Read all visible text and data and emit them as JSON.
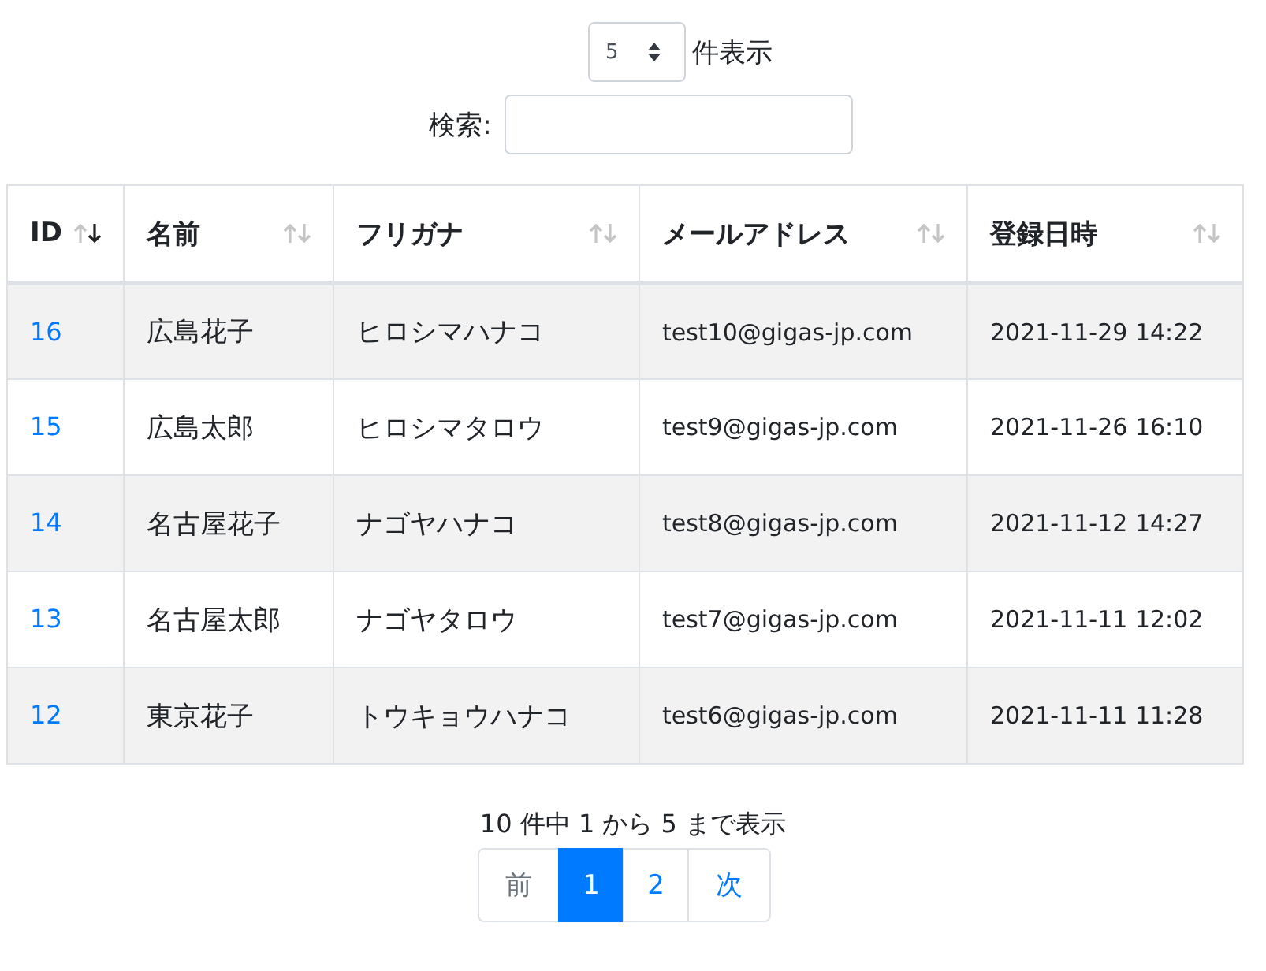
{
  "length_menu": {
    "value": "5",
    "label": "件表示"
  },
  "search": {
    "label": "検索:"
  },
  "table": {
    "columns": [
      {
        "label": "ID",
        "sorted": true
      },
      {
        "label": "名前",
        "sorted": false
      },
      {
        "label": "フリガナ",
        "sorted": false
      },
      {
        "label": "メールアドレス",
        "sorted": false
      },
      {
        "label": "登録日時",
        "sorted": false
      }
    ],
    "rows": [
      [
        "16",
        "広島花子",
        "ヒロシマハナコ",
        "test10@gigas-jp.com",
        "2021-11-29 14:22"
      ],
      [
        "15",
        "広島太郎",
        "ヒロシマタロウ",
        "test9@gigas-jp.com",
        "2021-11-26 16:10"
      ],
      [
        "14",
        "名古屋花子",
        "ナゴヤハナコ",
        "test8@gigas-jp.com",
        "2021-11-12 14:27"
      ],
      [
        "13",
        "名古屋太郎",
        "ナゴヤタロウ",
        "test7@gigas-jp.com",
        "2021-11-11 12:02"
      ],
      [
        "12",
        "東京花子",
        "トウキョウハナコ",
        "test6@gigas-jp.com",
        "2021-11-11 11:28"
      ]
    ]
  },
  "info": "10 件中 1 から 5 まで表示",
  "pagination": [
    {
      "label": "前",
      "selected": false,
      "disabled": true
    },
    {
      "label": "1",
      "selected": true,
      "disabled": false
    },
    {
      "label": "2",
      "selected": false,
      "disabled": false
    },
    {
      "label": "次",
      "selected": false,
      "disabled": false
    }
  ]
}
